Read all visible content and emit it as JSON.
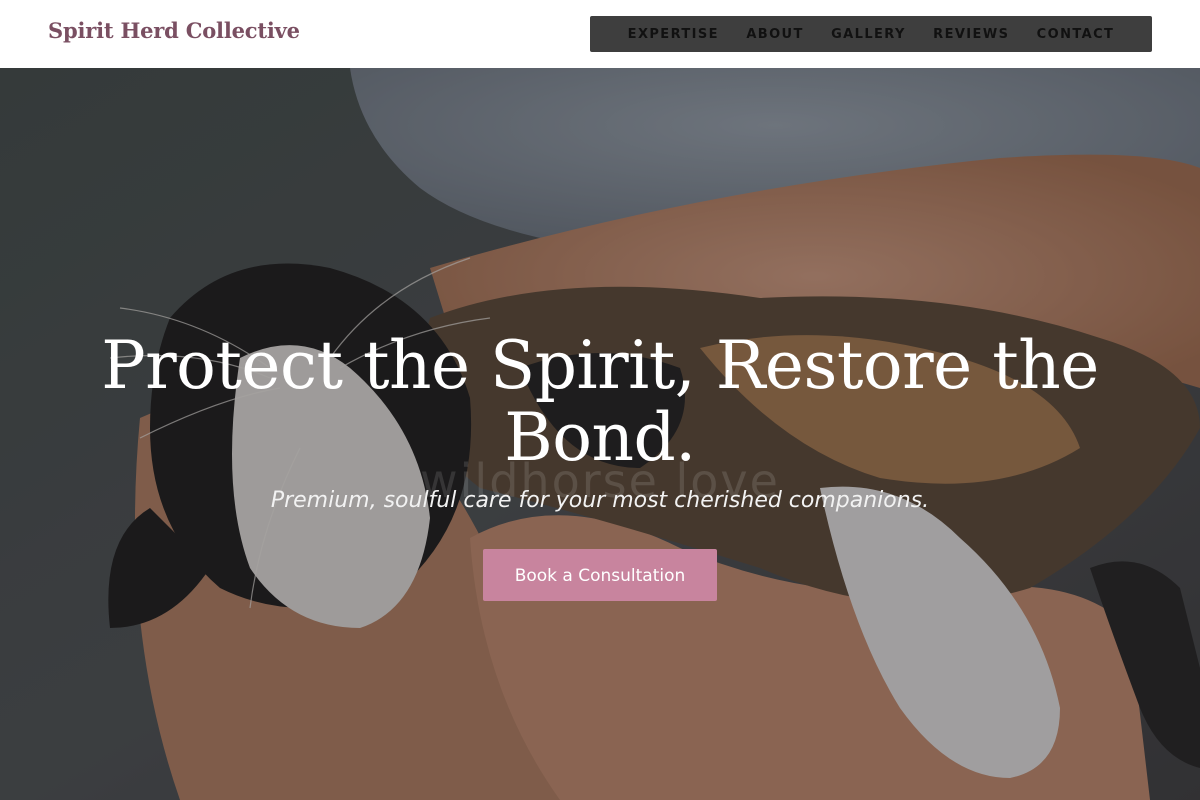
{
  "header": {
    "brand": "Spirit Herd Collective",
    "nav": [
      "EXPERTISE",
      "ABOUT",
      "GALLERY",
      "REVIEWS",
      "CONTACT"
    ]
  },
  "hero": {
    "title": "Protect the Spirit, Restore the Bond.",
    "subtitle": "Premium, soulful care for your most cherished companions.",
    "cta": "Book a Consultation",
    "watermark": "wildhorse love"
  },
  "colors": {
    "brand": "#7a4f62",
    "nav_background": "#3e3e3e",
    "cta_background": "#c8849e"
  }
}
